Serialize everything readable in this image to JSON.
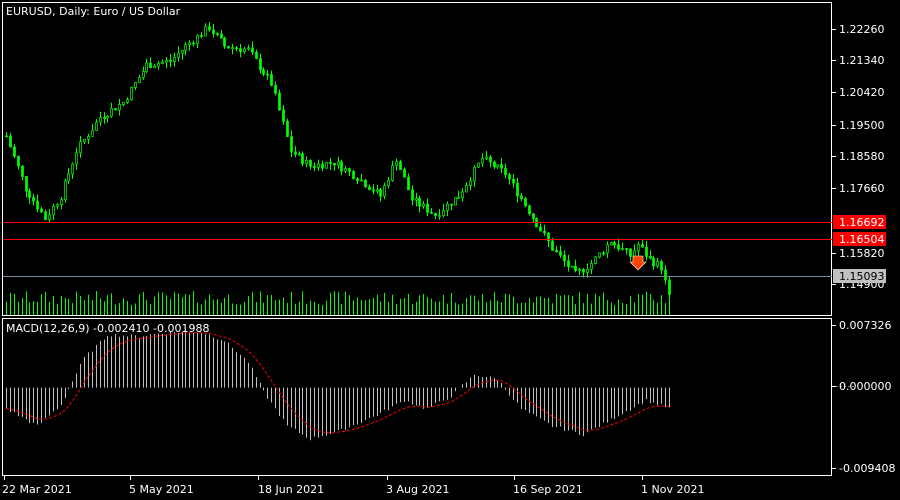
{
  "window": {
    "symbol": "EURUSD",
    "timeframe": "Daily",
    "description": "Euro / US Dollar",
    "title": "EURUSD, Daily:  Euro / US Dollar"
  },
  "colors": {
    "background": "#000000",
    "candle": "#00ff00",
    "axis": "#ffffff",
    "level_line": "#ff0000",
    "level_label_bg": "#ff0000",
    "bid_line": "#778899",
    "bid_label_bg": "#c0c0c0",
    "macd_hist": "#c0c0c0",
    "macd_signal": "#ff0000",
    "arrow": "#ff4400"
  },
  "price_axis": {
    "ticks": [
      "1.22260",
      "1.21340",
      "1.20420",
      "1.19500",
      "1.18580",
      "1.17660",
      "1.15820",
      "1.14900"
    ],
    "levels": [
      "1.16692",
      "1.16504"
    ],
    "bid": "1.15093",
    "range": [
      1.1462,
      1.2295
    ]
  },
  "macd_panel": {
    "title": "MACD(12,26,9) -0.002410 -0.001988",
    "ticks": [
      "0.007326",
      "0.000000",
      "-0.009408"
    ],
    "range": [
      -0.009408,
      0.007326
    ]
  },
  "time_axis": {
    "labels": [
      "22 Mar 2021",
      "5 May 2021",
      "18 Jun 2021",
      "3 Aug 2021",
      "16 Sep 2021",
      "1 Nov 2021"
    ]
  },
  "chart_data": {
    "type": "candlestick",
    "bar_count": 171,
    "price_anchors": [
      [
        0,
        1.194
      ],
      [
        5,
        1.18
      ],
      [
        10,
        1.172
      ],
      [
        14,
        1.178
      ],
      [
        18,
        1.19
      ],
      [
        24,
        1.199
      ],
      [
        30,
        1.203
      ],
      [
        36,
        1.213
      ],
      [
        42,
        1.214
      ],
      [
        46,
        1.218
      ],
      [
        52,
        1.223
      ],
      [
        56,
        1.218
      ],
      [
        62,
        1.217
      ],
      [
        68,
        1.208
      ],
      [
        73,
        1.19
      ],
      [
        78,
        1.186
      ],
      [
        84,
        1.187
      ],
      [
        90,
        1.183
      ],
      [
        96,
        1.178
      ],
      [
        100,
        1.188
      ],
      [
        104,
        1.177
      ],
      [
        110,
        1.173
      ],
      [
        116,
        1.178
      ],
      [
        122,
        1.188
      ],
      [
        128,
        1.184
      ],
      [
        134,
        1.174
      ],
      [
        140,
        1.164
      ],
      [
        146,
        1.157
      ],
      [
        150,
        1.16
      ],
      [
        155,
        1.166
      ],
      [
        160,
        1.162
      ],
      [
        162,
        1.165
      ],
      [
        165,
        1.161
      ],
      [
        168,
        1.159
      ],
      [
        170,
        1.1509
      ]
    ],
    "macd_anchors": [
      [
        0,
        -0.0025
      ],
      [
        8,
        -0.0045
      ],
      [
        14,
        -0.002
      ],
      [
        20,
        0.0035
      ],
      [
        26,
        0.0062
      ],
      [
        34,
        0.006
      ],
      [
        42,
        0.0065
      ],
      [
        50,
        0.0065
      ],
      [
        56,
        0.0055
      ],
      [
        62,
        0.003
      ],
      [
        66,
        -0.0005
      ],
      [
        72,
        -0.0045
      ],
      [
        78,
        -0.006
      ],
      [
        86,
        -0.005
      ],
      [
        96,
        -0.003
      ],
      [
        102,
        -0.0015
      ],
      [
        108,
        -0.0025
      ],
      [
        114,
        -0.001
      ],
      [
        120,
        0.0015
      ],
      [
        126,
        0.001
      ],
      [
        132,
        -0.0025
      ],
      [
        140,
        -0.0045
      ],
      [
        148,
        -0.0055
      ],
      [
        156,
        -0.0035
      ],
      [
        164,
        -0.0015
      ],
      [
        170,
        -0.0024
      ]
    ]
  }
}
